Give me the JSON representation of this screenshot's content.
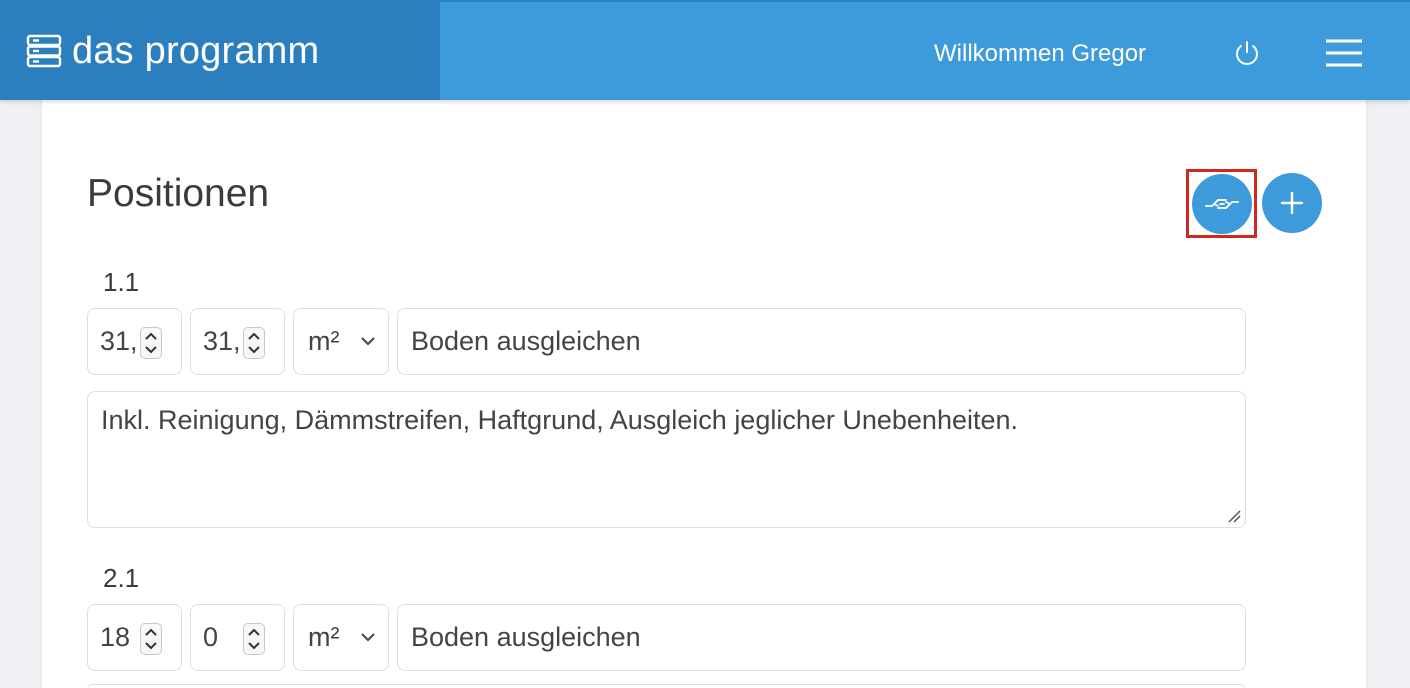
{
  "header": {
    "brand_icon": "server-stack-icon",
    "app_title": "das programm",
    "welcome_text": "Willkommen Gregor",
    "power_icon": "power-icon",
    "menu_icon": "hamburger-menu-icon",
    "colors": {
      "header": "#3d9bdc",
      "brand": "#2c7fbf"
    }
  },
  "main": {
    "section_title": "Positionen",
    "actions": {
      "link_icon": "handshake-icon",
      "add_icon": "plus-icon",
      "highlight_color": "#d0291b"
    },
    "positions": [
      {
        "number": "1.1",
        "quantity": "31,",
        "quantity2": "31,",
        "unit": "m²",
        "title": "Boden ausgleichen",
        "description": "Inkl. Reinigung, Dämmstreifen, Haftgrund, Ausgleich jeglicher Unebenheiten."
      },
      {
        "number": "2.1",
        "quantity": "18",
        "quantity2": "0",
        "unit": "m²",
        "title": "Boden ausgleichen"
      }
    ]
  }
}
